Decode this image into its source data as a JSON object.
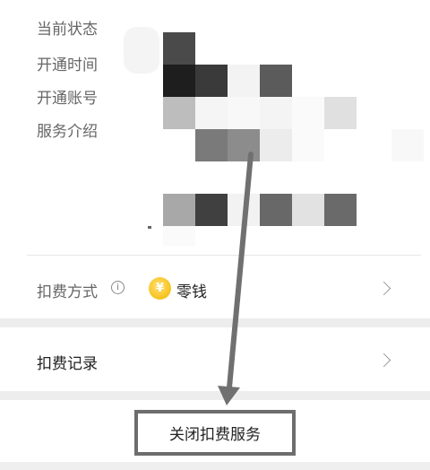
{
  "info": {
    "status_label": "当前状态",
    "open_time_label": "开通时间",
    "open_account_label": "开通账号",
    "description_label": "服务介绍"
  },
  "payment": {
    "method_label": "扣费方式",
    "info_glyph": "i",
    "coin_glyph": "¥",
    "method_value": "零钱"
  },
  "records": {
    "label": "扣费记录"
  },
  "close_service_label": "关闭扣费服务",
  "icons": {
    "method_chevron": "chevron-right-icon",
    "records_chevron": "chevron-right-icon",
    "info": "info-circle-icon",
    "coin": "wechat-change-coin-icon"
  },
  "colors": {
    "highlight_box": "#6d6d6d",
    "arrow": "#707070",
    "coin": "#f6c11a"
  }
}
